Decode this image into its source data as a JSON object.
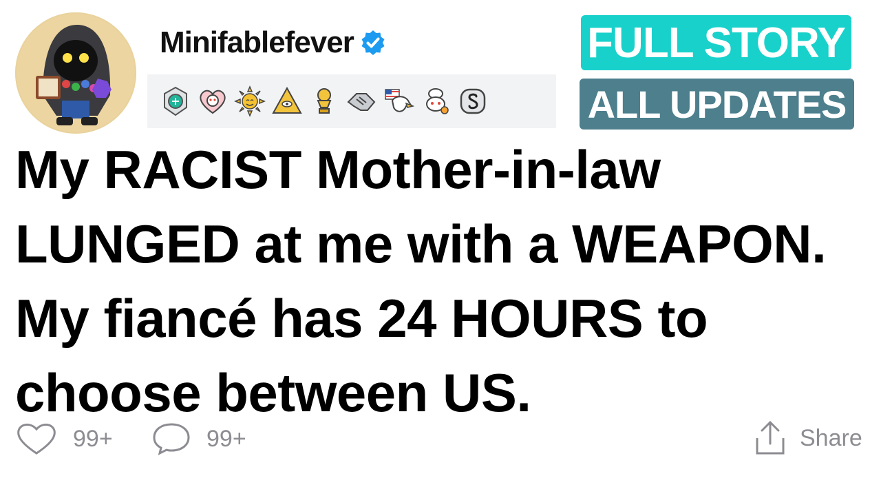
{
  "post": {
    "username": "Minifablefever",
    "verified": true,
    "headline": "My RACIST Mother-in-law LUNGED at me with a WEAPON. My fiancé has 24 HOURS to choose between US.",
    "awards": [
      "wholesome-award-icon",
      "heart-snoo-award-icon",
      "sun-award-icon",
      "illuminati-award-icon",
      "gold-trophy-award-icon",
      "handshake-award-icon",
      "eagle-award-icon",
      "snoo-chef-award-icon",
      "silver-coin-award-icon"
    ]
  },
  "badges": {
    "full_story": "FULL STORY",
    "all_updates": "ALL UPDATES",
    "full_story_color": "#19d1cb",
    "all_updates_color": "#4d7f8d"
  },
  "actions": {
    "likes": "99+",
    "comments": "99+",
    "share_label": "Share"
  },
  "colors": {
    "verified_blue": "#1d9bf0",
    "muted_text": "#8c8c92"
  }
}
